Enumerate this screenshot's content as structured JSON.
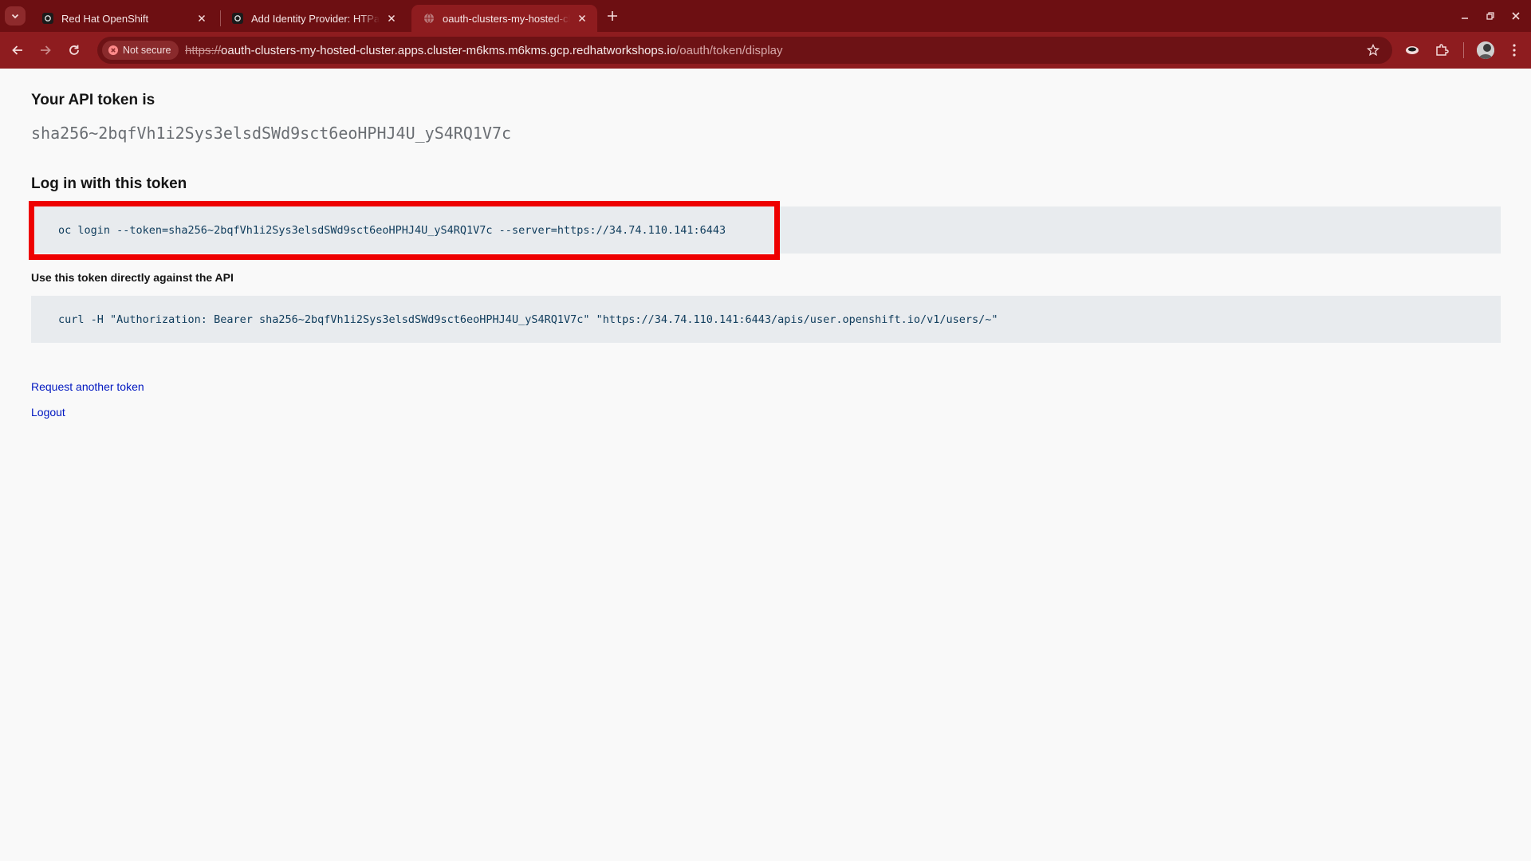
{
  "browser": {
    "tabs": [
      {
        "title": "Red Hat OpenShift",
        "active": false
      },
      {
        "title": "Add Identity Provider: HTPasswd",
        "active": false
      },
      {
        "title": "oauth-clusters-my-hosted-cluster",
        "active": true
      }
    ],
    "security_chip": "Not secure",
    "url": {
      "scheme": "https://",
      "host": "oauth-clusters-my-hosted-cluster.apps.cluster-m6kms.m6kms.gcp.redhatworkshops.io",
      "path": "/oauth/token/display"
    },
    "colors": {
      "tabstrip": "#6d0f12",
      "toolbar": "#8e1c1f"
    }
  },
  "page": {
    "token_heading": "Your API token is",
    "token_value": "sha256~2bqfVh1i2Sys3elsdSWd9sct6eoHPHJ4U_yS4RQ1V7c",
    "login_heading": "Log in with this token",
    "login_command": "oc login --token=sha256~2bqfVh1i2Sys3elsdSWd9sct6eoHPHJ4U_yS4RQ1V7c --server=https://34.74.110.141:6443",
    "api_heading": "Use this token directly against the API",
    "api_command": "curl -H \"Authorization: Bearer sha256~2bqfVh1i2Sys3elsdSWd9sct6eoHPHJ4U_yS4RQ1V7c\" \"https://34.74.110.141:6443/apis/user.openshift.io/v1/users/~\"",
    "request_link": "Request another token",
    "logout_link": "Logout",
    "highlight_color": "#ee0000"
  }
}
